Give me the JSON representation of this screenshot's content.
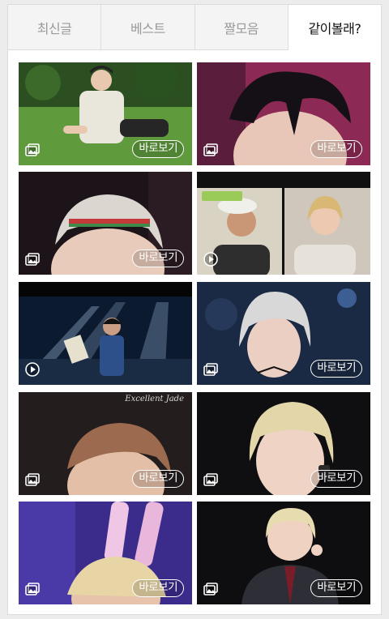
{
  "tabs": [
    {
      "label": "최신글",
      "active": false
    },
    {
      "label": "베스트",
      "active": false
    },
    {
      "label": "짤모음",
      "active": false
    },
    {
      "label": "같이볼래?",
      "active": true
    }
  ],
  "colors": {
    "active_tab_text": "#111111",
    "inactive_tab_text": "#9a9a9a",
    "inactive_tab_bg": "#f4f4f4"
  },
  "cards": [
    {
      "media_icon": "image-icon",
      "button": "바로보기"
    },
    {
      "media_icon": "image-icon",
      "button": "바로보기"
    },
    {
      "media_icon": "image-icon",
      "button": "바로보기"
    },
    {
      "media_icon": "play-icon",
      "button": ""
    },
    {
      "media_icon": "play-icon",
      "button": ""
    },
    {
      "media_icon": "image-icon",
      "button": "바로보기"
    },
    {
      "media_icon": "image-icon",
      "button": "바로보기"
    },
    {
      "media_icon": "image-icon",
      "button": "바로보기"
    },
    {
      "media_icon": "image-icon",
      "button": "바로보기"
    },
    {
      "media_icon": "image-icon",
      "button": "바로보기"
    }
  ],
  "overlay_texts": {
    "card7_caption": "Excellent Jade"
  }
}
